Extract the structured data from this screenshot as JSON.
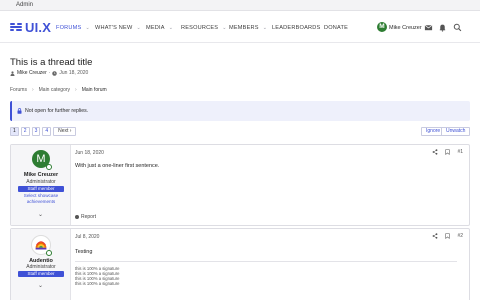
{
  "admin_bar": {
    "link": "Admin"
  },
  "header": {
    "logo_text": "UI.X",
    "nav": [
      {
        "label": "FORUMS",
        "active": true,
        "has_dropdown": true
      },
      {
        "label": "WHAT'S NEW",
        "active": false,
        "has_dropdown": true
      },
      {
        "label": "MEDIA",
        "active": false,
        "has_dropdown": true
      },
      {
        "label": "RESOURCES",
        "active": false,
        "has_dropdown": true
      },
      {
        "label": "MEMBERS",
        "active": false,
        "has_dropdown": true
      },
      {
        "label": "LEADERBOARDS",
        "active": false,
        "has_dropdown": false
      },
      {
        "label": "DONATE",
        "active": false,
        "has_dropdown": false
      }
    ],
    "user": {
      "avatar_letter": "M",
      "name": "Mike Creuzer"
    },
    "icons": [
      "envelope-icon",
      "bell-icon",
      "search-icon"
    ]
  },
  "thread": {
    "title": "This is a thread title",
    "author": "Mike Creuzer",
    "date": "Jun 18, 2020"
  },
  "breadcrumb": [
    "Forums",
    "Main category",
    "Main forum"
  ],
  "notice": {
    "icon": "lock-icon",
    "text": "Not open for further replies."
  },
  "pagination": {
    "pages": [
      "1",
      "2",
      "3",
      "4"
    ],
    "current": "1",
    "next_label": "Next"
  },
  "thread_actions": {
    "ignore": "Ignore",
    "unwatch": "Unwatch"
  },
  "posts": [
    {
      "avatar_letter": "M",
      "username": "Mike Creuzer",
      "user_title": "Administrator",
      "banner": "Staff member",
      "showcase": "Select showcase achievements",
      "date": "Jun 18, 2020",
      "number": "#1",
      "text": "With just a one-liner first sentence.",
      "report": "Report"
    },
    {
      "username": "Audentio",
      "user_title": "Administrator",
      "banner": "Staff member",
      "date": "Jul 8, 2020",
      "number": "#2",
      "text": "Testing",
      "signature": [
        "this is 100% a signature",
        "this is 100% a signature",
        "this is 100% a signature",
        "this is 100% a signature"
      ]
    }
  ],
  "colors": {
    "accent": "#3f51d6",
    "avatar_green": "#2e7d32"
  }
}
